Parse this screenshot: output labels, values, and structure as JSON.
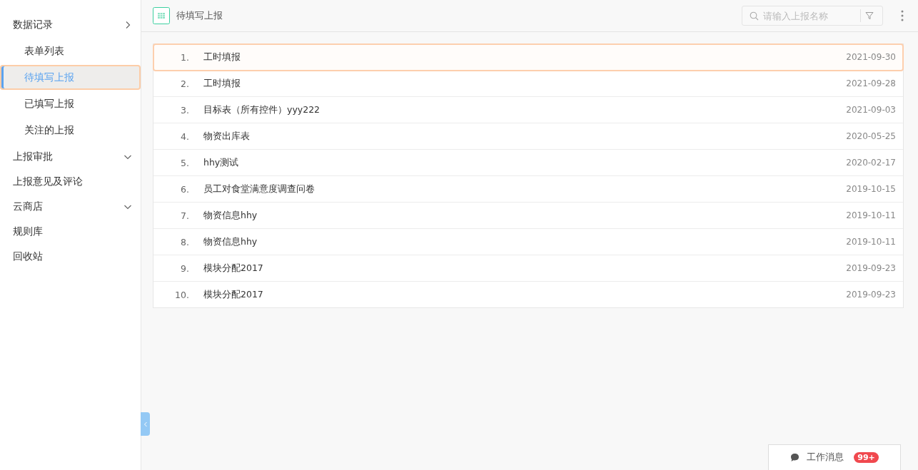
{
  "sidebar": {
    "items": [
      {
        "label": "数据记录",
        "expanded": true,
        "children": [
          {
            "label": "表单列表",
            "selected": false
          },
          {
            "label": "待填写上报",
            "selected": true
          },
          {
            "label": "已填写上报",
            "selected": false
          },
          {
            "label": "关注的上报",
            "selected": false
          }
        ]
      },
      {
        "label": "上报审批",
        "expanded": false
      },
      {
        "label": "上报意见及评论"
      },
      {
        "label": "云商店",
        "expanded": false
      },
      {
        "label": "规则库"
      },
      {
        "label": "回收站"
      }
    ]
  },
  "header": {
    "title": "待填写上报",
    "search": {
      "placeholder": "请输入上报名称"
    }
  },
  "list": [
    {
      "index": "1.",
      "name": "工时填报",
      "date": "2021-09-30",
      "selected": true
    },
    {
      "index": "2.",
      "name": "工时填报",
      "date": "2021-09-28",
      "selected": false
    },
    {
      "index": "3.",
      "name": "目标表（所有控件）yyy222",
      "date": "2021-09-03",
      "selected": false
    },
    {
      "index": "4.",
      "name": "物资出库表",
      "date": "2020-05-25",
      "selected": false
    },
    {
      "index": "5.",
      "name": "hhy测试",
      "date": "2020-02-17",
      "selected": false
    },
    {
      "index": "6.",
      "name": "员工对食堂满意度调查问卷",
      "date": "2019-10-15",
      "selected": false
    },
    {
      "index": "7.",
      "name": "物资信息hhy",
      "date": "2019-10-11",
      "selected": false
    },
    {
      "index": "8.",
      "name": "物资信息hhy",
      "date": "2019-10-11",
      "selected": false
    },
    {
      "index": "9.",
      "name": "模块分配2017",
      "date": "2019-09-23",
      "selected": false
    },
    {
      "index": "10.",
      "name": "模块分配2017",
      "date": "2019-09-23",
      "selected": false
    }
  ],
  "messages": {
    "label": "工作消息",
    "badge": "99+"
  }
}
